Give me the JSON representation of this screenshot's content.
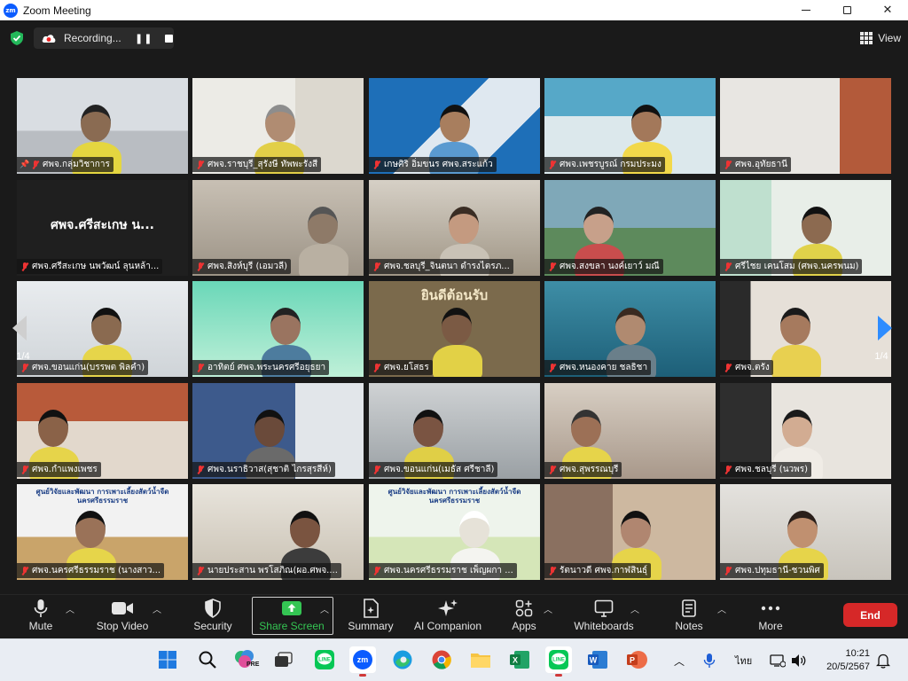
{
  "window": {
    "title": "Zoom Meeting"
  },
  "topbar": {
    "recording_label": "Recording...",
    "view_label": "View"
  },
  "pagination": {
    "left_page": "1/4",
    "right_page": "1/4"
  },
  "tiles": [
    {
      "name": "ศพจ.กลุ่มวิชาการ",
      "active": true,
      "pinned": true
    },
    {
      "name": "ศพจ.ราชบุรี_สุรังษี ทัพพะรังสี"
    },
    {
      "name": "เกษศิริ อิ่มขนร  ศพจ.สระแก้ว"
    },
    {
      "name": "ศพจ.เพชรบูรณ์ กรมประมง"
    },
    {
      "name": "ศพจ.อุทัยธานี"
    },
    {
      "name": "ศพจ.ศรีสะเกษ นพวัฒน์ ลุนหล้า...",
      "center_label": "ศพจ.ศรีสะเกษ น..."
    },
    {
      "name": "ศพจ.สิงห์บุรี (เอมวลี)"
    },
    {
      "name": "ศพจ.ชลบุรี_จินตนา ดำรงไตรภ..."
    },
    {
      "name": "ศพจ.สงขลา นงค์เยาว์ มณี"
    },
    {
      "name": "ศรีไชย เคนโสม (ศพจ.นครพนม)"
    },
    {
      "name": "ศพจ.ขอนแก่น(บรรพต พิลคำ)"
    },
    {
      "name": "อาทิตย์ ศพจ.พระนครศรีอยุธยา"
    },
    {
      "name": "ศพจ.ยโสธร",
      "banner": "ยินดีต้อนรับ"
    },
    {
      "name": "ศพจ.หนองคาย ชลธิชา"
    },
    {
      "name": "ศพจ.ตรัง"
    },
    {
      "name": "ศพจ.กำแพงเพชร"
    },
    {
      "name": "ศพจ.นราธิวาส(สุชาติ ไกรสุรสีห์)"
    },
    {
      "name": "ศพจ.ขอนแก่น(เมธัส ศรีชาลี)"
    },
    {
      "name": "ศพจ.สุพรรณบุรี"
    },
    {
      "name": "ศพจ.ชลบุรี (นวพร)"
    },
    {
      "name": "ศพจ.นครศรีธรรมราช (นางสาว...",
      "banner": "ศูนย์วิจัยและพัฒนา การเพาะเลี้ยงสัตว์น้ำจืดนครศรีธรรมราช"
    },
    {
      "name": "นายประสาน พรโสภิณ(ผอ.ศพจ...."
    },
    {
      "name": "ศพจ.นครศรีธรรมราช เพ็ญผกา ...",
      "banner": "ศูนย์วิจัยและพัฒนา การเพาะเลี้ยงสัตว์น้ำจืดนครศรีธรรมราช"
    },
    {
      "name": "รัตนาวดี ศพจ.กาฬสินธุ์"
    },
    {
      "name": "ศพจ.ปทุมธานี-ชวนพิศ"
    }
  ],
  "toolbar": {
    "mute": "Mute",
    "stop_video": "Stop Video",
    "security": "Security",
    "share_screen": "Share Screen",
    "summary": "Summary",
    "ai_companion": "AI Companion",
    "apps": "Apps",
    "whiteboards": "Whiteboards",
    "notes": "Notes",
    "more": "More",
    "end": "End"
  },
  "taskbar": {
    "apps": [
      "windows-start",
      "search",
      "copilot",
      "task-view",
      "line",
      "zoom",
      "edge",
      "chrome",
      "file-explorer",
      "excel",
      "line",
      "word",
      "powerpoint"
    ],
    "pre_badge": "PRE",
    "language": "ไทย",
    "time": "10:21",
    "date": "20/5/2567"
  },
  "colors": {
    "active_speaker": "#e7e33a",
    "share_green": "#34c553",
    "end_red": "#d62828",
    "zoom_blue": "#0b5cff"
  }
}
